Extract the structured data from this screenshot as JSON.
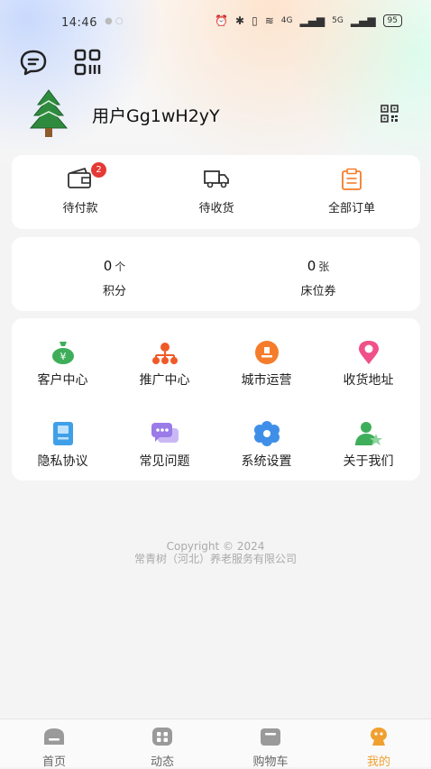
{
  "status_bar": {
    "time": "14:46",
    "battery": "95",
    "network_a": "4G",
    "network_b": "5G"
  },
  "user": {
    "name": "用户Gg1wH2yY"
  },
  "orders": [
    {
      "label": "待付款",
      "badge": "2",
      "icon": "wallet-icon"
    },
    {
      "label": "待收货",
      "icon": "truck-icon"
    },
    {
      "label": "全部订单",
      "icon": "clipboard-icon"
    }
  ],
  "stats": [
    {
      "value": "0",
      "unit": "个",
      "label": "积分"
    },
    {
      "value": "0",
      "unit": "张",
      "label": "床位券"
    }
  ],
  "menu": [
    {
      "label": "客户中心",
      "icon": "money-bag-icon"
    },
    {
      "label": "推广中心",
      "icon": "org-chart-icon"
    },
    {
      "label": "城市运营",
      "icon": "city-ops-icon"
    },
    {
      "label": "收货地址",
      "icon": "location-pin-icon"
    },
    {
      "label": "隐私协议",
      "icon": "document-icon"
    },
    {
      "label": "常见问题",
      "icon": "chat-bubbles-icon"
    },
    {
      "label": "系统设置",
      "icon": "settings-flower-icon"
    },
    {
      "label": "关于我们",
      "icon": "person-star-icon"
    }
  ],
  "footer": {
    "copyright": "Copyright © 2024",
    "company": "常青树（河北）养老服务有限公司"
  },
  "tabs": [
    {
      "label": "首页",
      "icon": "home-icon"
    },
    {
      "label": "动态",
      "icon": "feed-icon"
    },
    {
      "label": "购物车",
      "icon": "cart-icon"
    },
    {
      "label": "我的",
      "icon": "profile-icon",
      "active": true
    }
  ],
  "colors": {
    "accent": "#f0a030",
    "badge": "#e53935",
    "green": "#3fae5b",
    "orange": "#f57c2a",
    "pink": "#f0508a",
    "blue": "#3fa0e8",
    "purple": "#9a7be8"
  }
}
